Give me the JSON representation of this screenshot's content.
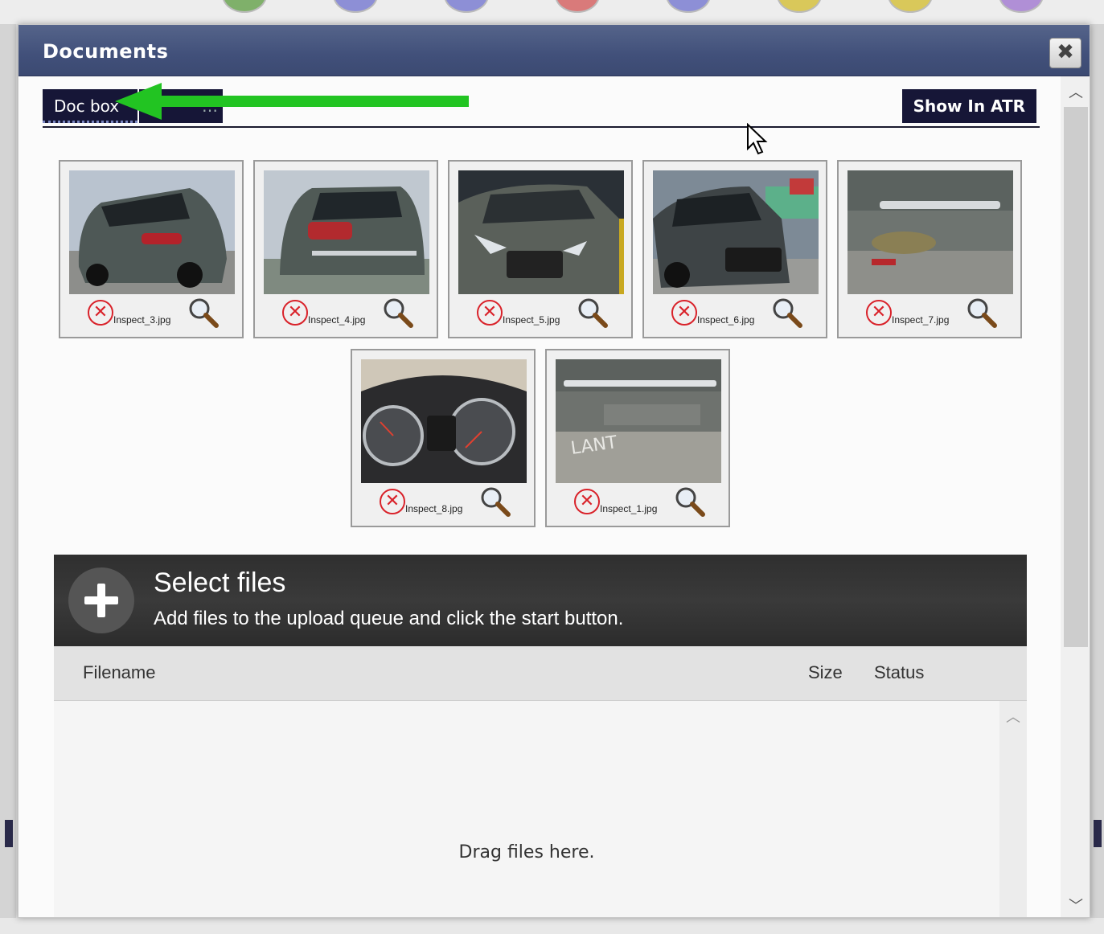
{
  "dialog": {
    "title": "Documents",
    "close_icon": "close-icon"
  },
  "tabs": [
    {
      "label": "Doc box",
      "active": true
    },
    {
      "label": "…t"
    }
  ],
  "toolbar": {
    "show_in_atr_label": "Show In ATR"
  },
  "thumbnails": [
    {
      "filename": "Inspect_3.jpg",
      "subject": "car-rear-three-quarter"
    },
    {
      "filename": "Inspect_4.jpg",
      "subject": "car-rear"
    },
    {
      "filename": "Inspect_5.jpg",
      "subject": "car-front"
    },
    {
      "filename": "Inspect_6.jpg",
      "subject": "car-front-three-quarter"
    },
    {
      "filename": "Inspect_7.jpg",
      "subject": "bumper-closeup"
    },
    {
      "filename": "Inspect_8.jpg",
      "subject": "dashboard-instrument-cluster"
    },
    {
      "filename": "Inspect_1.jpg",
      "subject": "bumper-damage-ground"
    }
  ],
  "uploader": {
    "title": "Select files",
    "subtitle": "Add files to the upload queue and click the start button.",
    "columns": {
      "filename": "Filename",
      "size": "Size",
      "status": "Status"
    },
    "drop_text": "Drag files here."
  },
  "colors": {
    "titlebar": "#41507a",
    "tab_bg": "#161637",
    "delete_red": "#d9222a",
    "annotation_arrow": "#22c422",
    "uploader_header": "#333333"
  }
}
